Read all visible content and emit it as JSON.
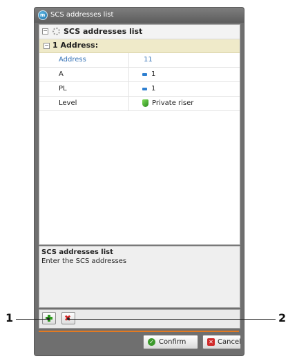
{
  "window": {
    "title": "SCS addresses list"
  },
  "grid": {
    "root_label": "SCS addresses list",
    "category_label": "1 Address:",
    "properties": [
      {
        "name": "Address",
        "value": "11",
        "icon": ""
      },
      {
        "name": "A",
        "value": "1",
        "icon": "number-icon"
      },
      {
        "name": "PL",
        "value": "1",
        "icon": "number-icon"
      },
      {
        "name": "Level",
        "value": "Private riser",
        "icon": "riser-icon"
      }
    ]
  },
  "description": {
    "title": "SCS addresses list",
    "text": "Enter the SCS addresses"
  },
  "buttons": {
    "add_icon": "plus-icon",
    "delete_icon": "delete-x-icon",
    "confirm": "Confirm",
    "cancel": "Cancel"
  },
  "callouts": [
    "1",
    "2"
  ],
  "colors": {
    "accent_line": "#e27a22",
    "category_bg": "#efeac9",
    "selected_text": "#3a76b8"
  }
}
